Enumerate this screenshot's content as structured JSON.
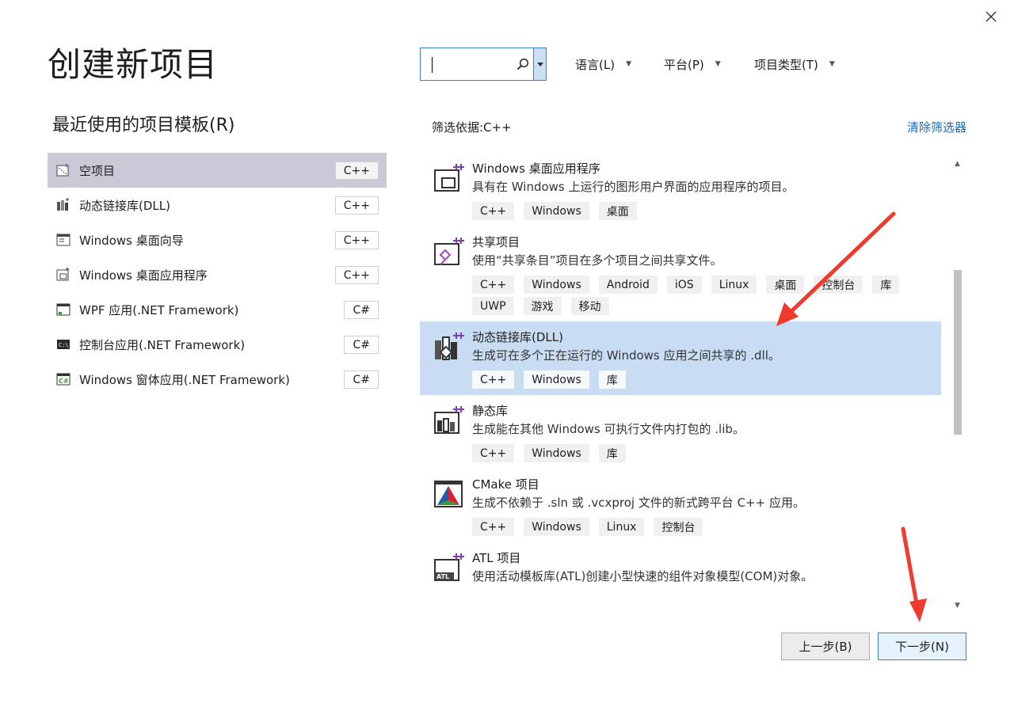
{
  "header": {
    "title": "创建新项目",
    "close_icon": "close-icon"
  },
  "search": {
    "value": "",
    "placeholder": ""
  },
  "filters": {
    "language": "语言(L)",
    "platform": "平台(P)",
    "project_type": "项目类型(T)",
    "filter_by": "筛选依据:C++",
    "clear": "清除筛选器"
  },
  "recent": {
    "title": "最近使用的项目模板(R)",
    "items": [
      {
        "label": "空项目",
        "lang": "C++",
        "icon": "empty-project-icon"
      },
      {
        "label": "动态链接库(DLL)",
        "lang": "C++",
        "icon": "dll-icon"
      },
      {
        "label": "Windows 桌面向导",
        "lang": "C++",
        "icon": "desktop-wizard-icon"
      },
      {
        "label": "Windows 桌面应用程序",
        "lang": "C++",
        "icon": "desktop-app-icon"
      },
      {
        "label": "WPF 应用(.NET Framework)",
        "lang": "C#",
        "icon": "wpf-icon"
      },
      {
        "label": "控制台应用(.NET Framework)",
        "lang": "C#",
        "icon": "console-icon"
      },
      {
        "label": "Windows 窗体应用(.NET Framework)",
        "lang": "C#",
        "icon": "winforms-icon"
      }
    ]
  },
  "templates": [
    {
      "name": "Windows 桌面应用程序",
      "desc": "具有在 Windows 上运行的图形用户界面的应用程序的项目。",
      "tags": [
        "C++",
        "Windows",
        "桌面"
      ],
      "icon": "desktop-app-icon"
    },
    {
      "name": "共享项目",
      "desc": "使用“共享条目”项目在多个项目之间共享文件。",
      "tags": [
        "C++",
        "Windows",
        "Android",
        "iOS",
        "Linux",
        "桌面",
        "控制台",
        "库",
        "UWP",
        "游戏",
        "移动"
      ],
      "icon": "shared-project-icon"
    },
    {
      "name": "动态链接库(DLL)",
      "desc": "生成可在多个正在运行的 Windows 应用之间共享的 .dll。",
      "tags": [
        "C++",
        "Windows",
        "库"
      ],
      "icon": "dll-icon"
    },
    {
      "name": "静态库",
      "desc": "生成能在其他 Windows 可执行文件内打包的 .lib。",
      "tags": [
        "C++",
        "Windows",
        "库"
      ],
      "icon": "static-lib-icon"
    },
    {
      "name": "CMake 项目",
      "desc": "生成不依赖于 .sln 或 .vcxproj 文件的新式跨平台 C++ 应用。",
      "tags": [
        "C++",
        "Windows",
        "Linux",
        "控制台"
      ],
      "icon": "cmake-icon"
    },
    {
      "name": "ATL 项目",
      "desc": "使用活动模板库(ATL)创建小型快速的组件对象模型(COM)对象。",
      "tags": [],
      "icon": "atl-icon"
    }
  ],
  "buttons": {
    "back": "上一步(B)",
    "next": "下一步(N)"
  },
  "colors": {
    "accent": "#3c7fd0",
    "selected_template": "#c8ddf3",
    "selected_recent": "#c9c9d8",
    "link": "#1a67b5",
    "annotation_arrow": "#f03a2e"
  }
}
